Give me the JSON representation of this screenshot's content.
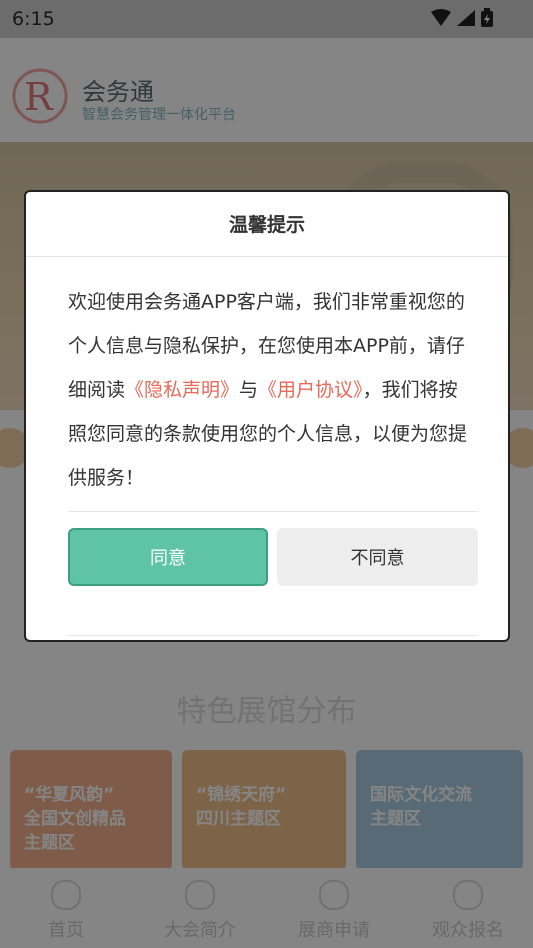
{
  "status_bar": {
    "time": "6:15"
  },
  "app": {
    "brand_name": "会务通",
    "slogan": "智慧会务管理一体化平台",
    "section_title": "特色展馆分布",
    "cards": [
      {
        "lines": [
          "“华夏风韵”",
          "全国文创精品",
          "主题区"
        ],
        "color": "#f1b08c"
      },
      {
        "lines": [
          "“锦绣天府”",
          "四川主题区"
        ],
        "color": "#f0c08c"
      },
      {
        "lines": [
          "国际文化交流",
          "主题区"
        ],
        "color": "#a9cbe3"
      }
    ],
    "tabbar": [
      {
        "label": "首页",
        "icon": "home-icon"
      },
      {
        "label": "大会简介",
        "icon": "info-icon"
      },
      {
        "label": "展商申请",
        "icon": "exhibitor-icon"
      },
      {
        "label": "观众报名",
        "icon": "user-icon"
      }
    ]
  },
  "dialog": {
    "title": "温馨提示",
    "body_part1": "欢迎使用会务通APP客户端，我们非常重视您的个人信息与隐私保护，在您使用本APP前，请仔细阅读",
    "privacy_link": "《隐私声明》",
    "body_and": "与",
    "agreement_link": "《用户协议》",
    "body_part2": "，我们将按照您同意的条款使用您的个人信息，以便为您提供服务！",
    "agree_label": "同意",
    "disagree_label": "不同意"
  },
  "colors": {
    "accent_green": "#5fc4a4",
    "link_red": "#e56a5a",
    "overlay": "rgba(0,0,0,0.48)"
  }
}
